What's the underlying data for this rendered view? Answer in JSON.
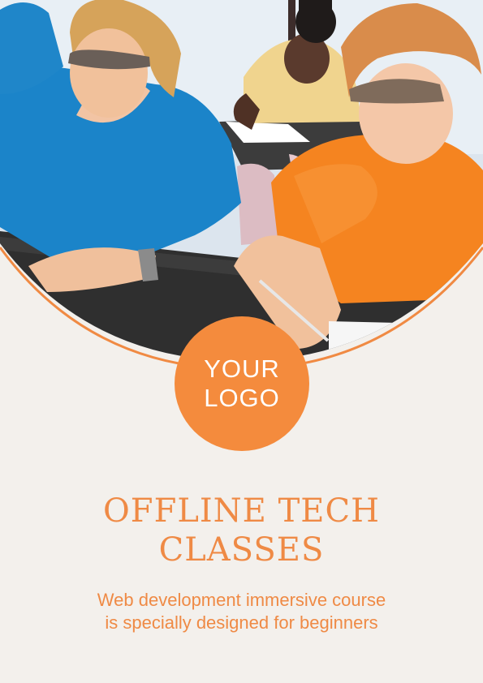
{
  "logo": {
    "line1": "YOUR",
    "line2": "LOGO"
  },
  "headline": {
    "line1": "OFFLINE TECH",
    "line2": "CLASSES"
  },
  "description": {
    "line1": "Web development immersive course",
    "line2": "is specially designed for beginners"
  },
  "colors": {
    "accent": "#f48b3d",
    "background": "#f3f0ec"
  }
}
